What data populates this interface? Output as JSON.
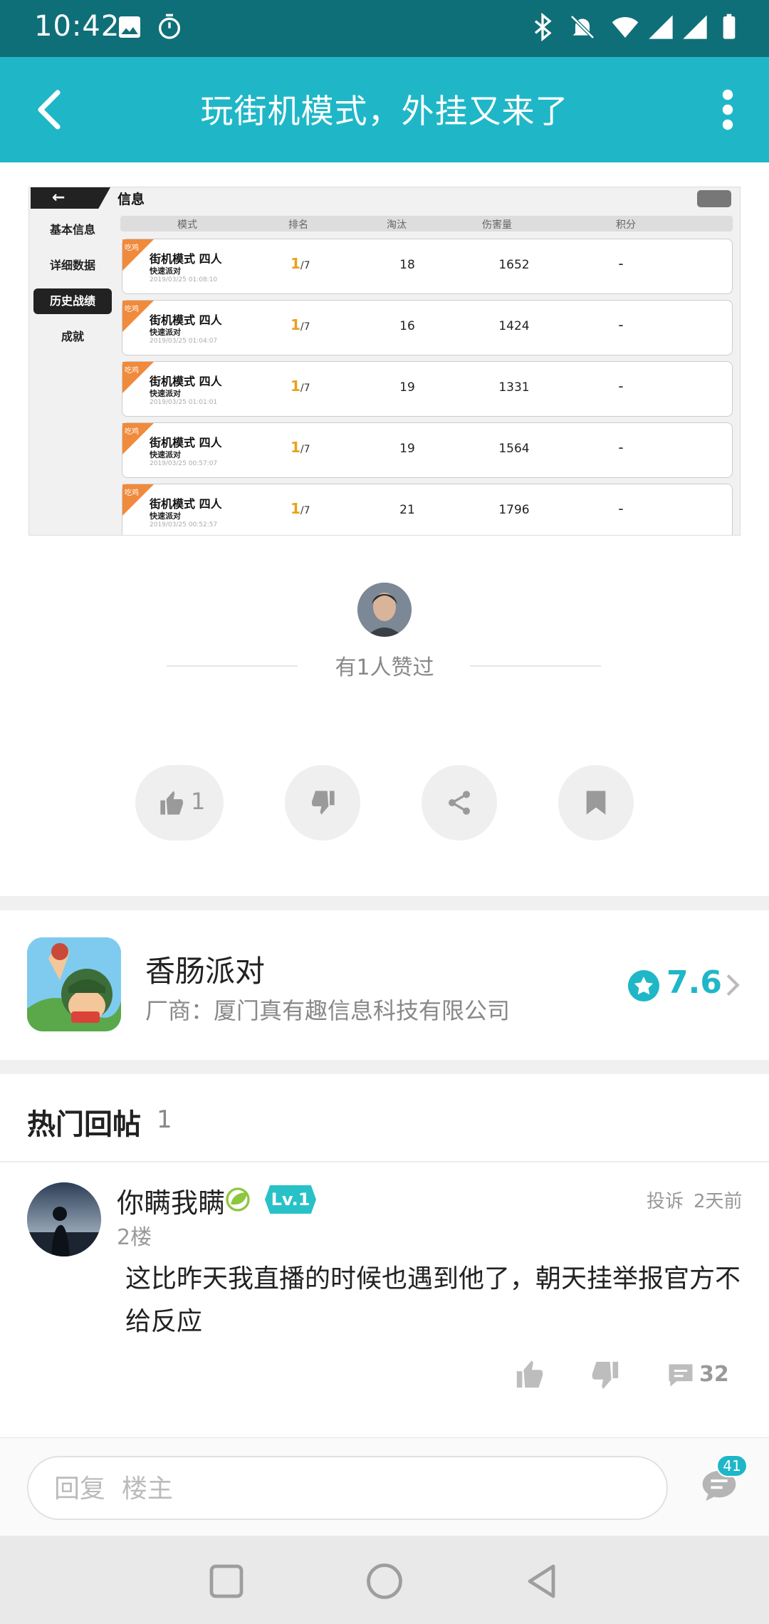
{
  "status_bar": {
    "time": "10:42"
  },
  "header": {
    "title": "玩街机模式，外挂又来了"
  },
  "screenshot": {
    "panel_title": "信息",
    "side_menu": [
      "基本信息",
      "详细数据",
      "历史战绩",
      "成就"
    ],
    "active_menu": "历史战绩",
    "columns": [
      "模式",
      "排名",
      "淘汰",
      "伤害量",
      "积分"
    ],
    "tag": "吃鸡",
    "rows": [
      {
        "mode": "街机模式 四人",
        "sub": "快速派对",
        "date": "2019/03/25  01:08:10",
        "rank": "1",
        "total": "/7",
        "kills": "18",
        "damage": "1652",
        "points": "-"
      },
      {
        "mode": "街机模式 四人",
        "sub": "快速派对",
        "date": "2019/03/25  01:04:07",
        "rank": "1",
        "total": "/7",
        "kills": "16",
        "damage": "1424",
        "points": "-"
      },
      {
        "mode": "街机模式 四人",
        "sub": "快速派对",
        "date": "2019/03/25  01:01:01",
        "rank": "1",
        "total": "/7",
        "kills": "19",
        "damage": "1331",
        "points": "-"
      },
      {
        "mode": "街机模式 四人",
        "sub": "快速派对",
        "date": "2019/03/25  00:57:07",
        "rank": "1",
        "total": "/7",
        "kills": "19",
        "damage": "1564",
        "points": "-"
      },
      {
        "mode": "街机模式 四人",
        "sub": "快速派对",
        "date": "2019/03/25  00:52:57",
        "rank": "1",
        "total": "/7",
        "kills": "21",
        "damage": "1796",
        "points": "-"
      }
    ]
  },
  "likes": {
    "text": "有1人赞过"
  },
  "actions": {
    "like_count": "1"
  },
  "game": {
    "name": "香肠派对",
    "maker": "厂商：厦门真有趣信息科技有限公司",
    "score": "7.6"
  },
  "hot_replies": {
    "title": "热门回帖",
    "count": "1"
  },
  "reply": {
    "user": "你瞒我瞒",
    "level": "Lv.1",
    "report": "投诉",
    "time": "2天前",
    "floor": "2楼",
    "content": "这比昨天我直播的时候也遇到他了，朝天挂举报官方不给反应",
    "comment_count": "32"
  },
  "reply_box": {
    "placeholder": "回复  楼主",
    "badge": "41"
  },
  "colors": {
    "accent": "#1fb7c7",
    "status_bar": "#0f6f78"
  }
}
